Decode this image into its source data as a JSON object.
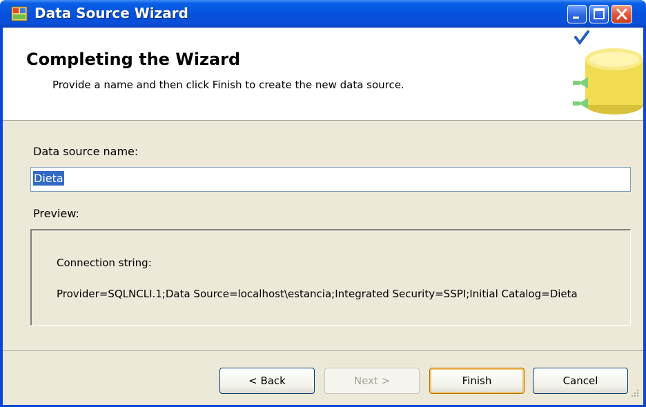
{
  "window": {
    "title": "Data Source Wizard"
  },
  "header": {
    "title": "Completing the Wizard",
    "subtitle": "Provide a name and then click Finish to create the new data source."
  },
  "form": {
    "name_label": "Data source name:",
    "name_value": "Dieta",
    "preview_label": "Preview:",
    "connection_label": "Connection string:",
    "connection_string": "Provider=SQLNCLI.1;Data Source=localhost\\estancia;Integrated Security=SSPI;Initial Catalog=Dieta"
  },
  "buttons": {
    "back": "< Back",
    "next": "Next >",
    "finish": "Finish",
    "cancel": "Cancel"
  },
  "colors": {
    "titlebar": "#0452dc",
    "selection": "#316ac5",
    "dialog_bg": "#ece9d8"
  }
}
